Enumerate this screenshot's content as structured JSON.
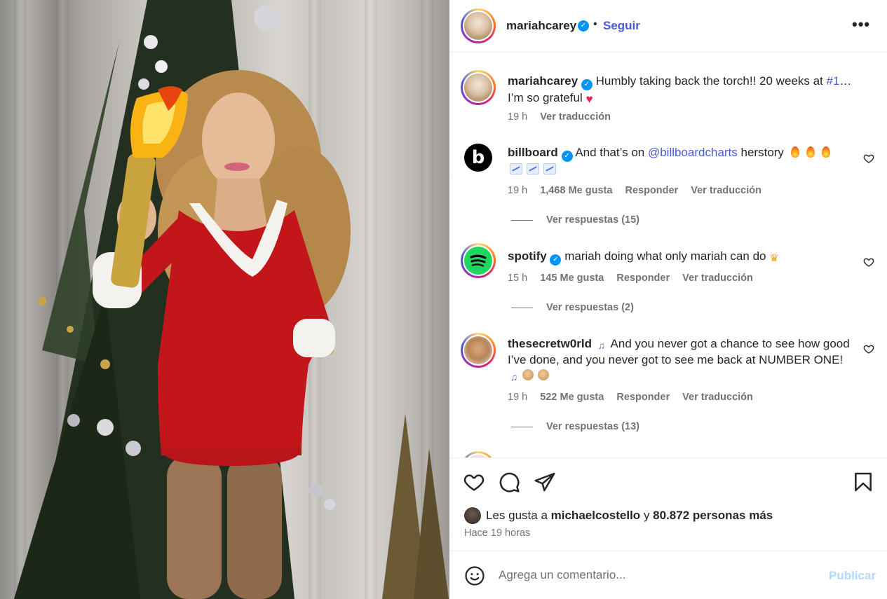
{
  "post": {
    "username": "mariahcarey",
    "follow_label": "Seguir",
    "dot": "•",
    "more_label": "•••",
    "caption": {
      "username": "mariahcarey",
      "text_before": "Humbly taking back the torch!! 20 weeks at ",
      "hashtag": "#1",
      "text_after": "… I’m so grateful",
      "time": "19 h",
      "translate": "Ver traducción"
    }
  },
  "comments": [
    {
      "username": "billboard",
      "text_before": "And that’s on ",
      "mention": "@billboardcharts",
      "text_after": " herstory",
      "time": "19 h",
      "likes": "1,468 Me gusta",
      "reply": "Responder",
      "translate": "Ver traducción",
      "replies": "Ver respuestas (15)"
    },
    {
      "username": "spotify",
      "text": "mariah doing what only mariah can do",
      "time": "15 h",
      "likes": "145 Me gusta",
      "reply": "Responder",
      "translate": "Ver traducción",
      "replies": "Ver respuestas (2)"
    },
    {
      "username": "thesecretw0rld",
      "text": "And you never got a chance to see how good I’ve done, and you never got to see me back at NUMBER ONE!",
      "time": "19 h",
      "likes": "522 Me gusta",
      "reply": "Responder",
      "translate": "Ver traducción",
      "replies": "Ver respuestas (13)"
    }
  ],
  "likes_summary": {
    "prefix": "Les gusta a",
    "user": "michaelcostello",
    "connector": "y",
    "others": "80.872 personas más"
  },
  "post_time": "Hace 19 horas",
  "comment_box": {
    "placeholder": "Agrega un comentario...",
    "publish_label": "Publicar"
  },
  "icons": {
    "verified": "verified-badge-icon",
    "like": "heart-icon",
    "comment": "comment-bubble-icon",
    "share": "paper-plane-icon",
    "save": "bookmark-icon",
    "emoji": "smiley-icon"
  },
  "colors": {
    "link": "#4a5ad4",
    "verified": "#0095f6",
    "publish_disabled": "#b3d8fb",
    "secondary_text": "#737373"
  }
}
